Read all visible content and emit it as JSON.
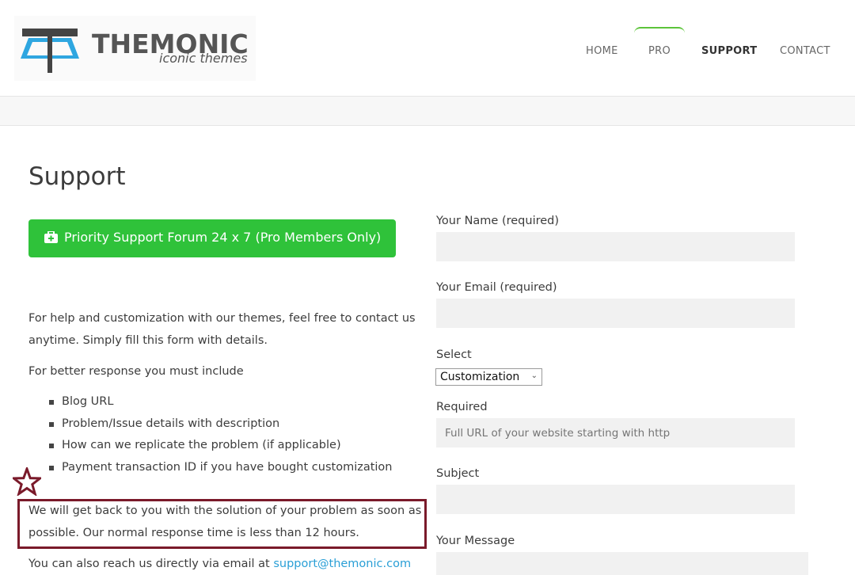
{
  "header": {
    "logo": {
      "name": "THEMONIC",
      "tagline": "iconic themes"
    },
    "nav": [
      {
        "label": "HOME"
      },
      {
        "label": "PRO"
      },
      {
        "label": "SUPPORT"
      },
      {
        "label": "CONTACT"
      }
    ],
    "active_nav": "SUPPORT"
  },
  "page": {
    "title": "Support",
    "forum_button": "Priority Support Forum 24 x 7 (Pro Members Only)",
    "intro_line1": "For help and customization with our themes, feel free to contact us",
    "intro_line2": "anytime. Simply fill this form with details.",
    "include_heading": "For better response you must include",
    "include_items": [
      "Blog URL",
      "Problem/Issue details with description",
      "How can we replicate the problem (if applicable)",
      "Payment transaction ID if you have bought customization"
    ],
    "response_line1": "We will get back to you with the solution of your problem as soon as",
    "response_line2": "possible. Our normal response time is less than 12 hours.",
    "email_prefix": "You can also reach us directly via email at ",
    "email": "support@themonic.com"
  },
  "form": {
    "name_label": "Your Name (required)",
    "email_label": "Your Email (required)",
    "select_label": "Select",
    "select_value": "Customization",
    "required_label": "Required",
    "url_placeholder": "Full URL of your website starting with http",
    "subject_label": "Subject",
    "message_label": "Your Message"
  },
  "colors": {
    "accent_green": "#2fc23a",
    "link_blue": "#2a9fd6",
    "highlight_border": "#7a1a2a"
  }
}
